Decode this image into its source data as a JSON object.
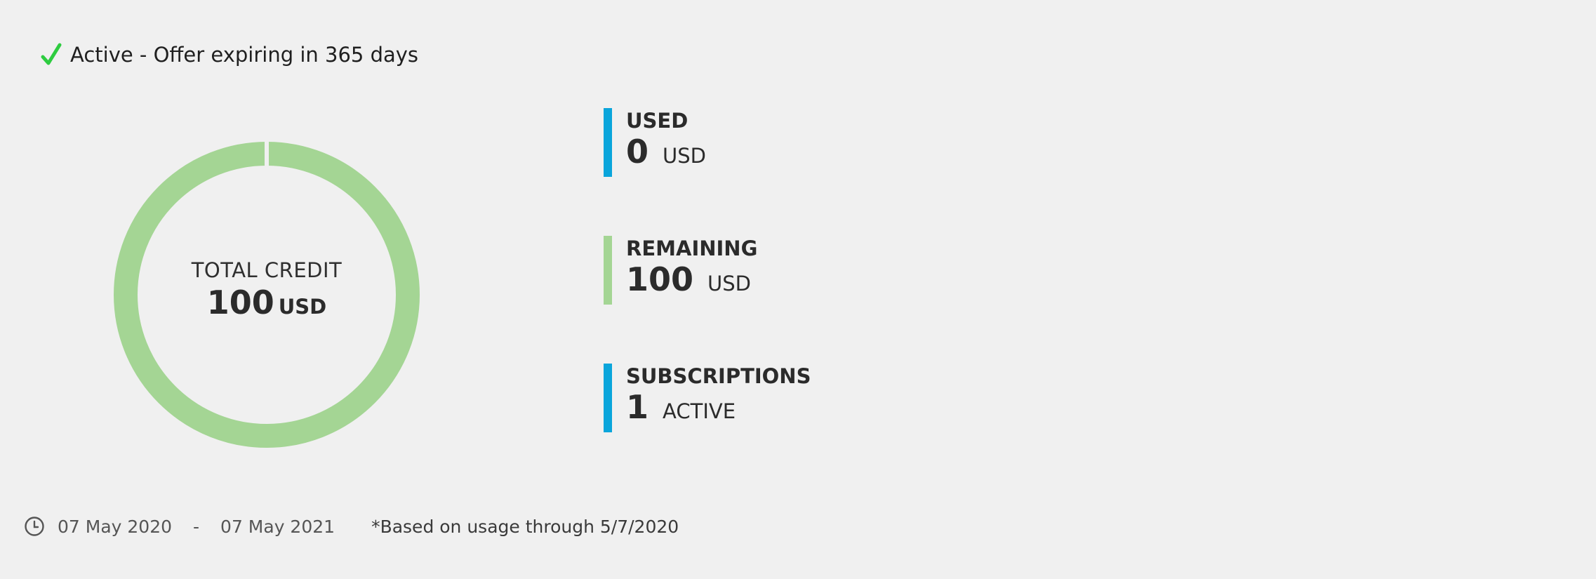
{
  "status": {
    "text": "Active - Offer expiring in 365 days",
    "icon": "check-icon",
    "color": "#2ecc40"
  },
  "total_credit": {
    "label": "TOTAL CREDIT",
    "value": "100",
    "unit": "USD",
    "ring_color": "#a4d594",
    "used_fraction": 0
  },
  "stats": [
    {
      "label": "USED",
      "value": "0",
      "unit": "USD",
      "color": "#0aa5db"
    },
    {
      "label": "REMAINING",
      "value": "100",
      "unit": "USD",
      "color": "#a4d594"
    },
    {
      "label": "SUBSCRIPTIONS",
      "value": "1",
      "unit": "ACTIVE",
      "color": "#0aa5db"
    }
  ],
  "footer": {
    "icon": "clock-icon",
    "start_date": "07 May 2020",
    "separator": "-",
    "end_date": "07 May 2021",
    "note": "*Based on usage through 5/7/2020"
  }
}
